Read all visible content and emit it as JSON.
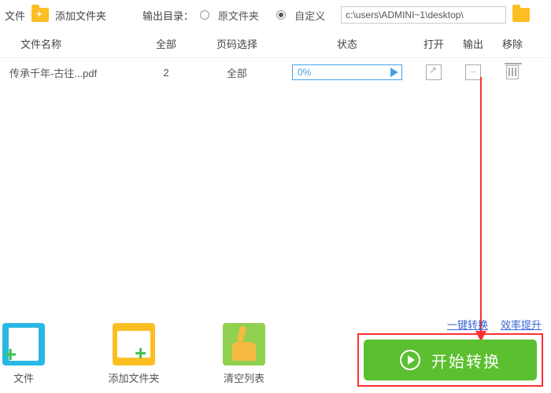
{
  "top": {
    "file_label": "文件",
    "add_folder_label": "添加文件夹",
    "output_label": "输出目录：",
    "radio_original": "原文件夹",
    "radio_custom": "自定义",
    "path": "c:\\users\\ADMINI~1\\desktop\\",
    "selected_radio": "custom"
  },
  "headers": {
    "name": "文件名称",
    "all": "全部",
    "page": "页码选择",
    "status": "状态",
    "open": "打开",
    "output": "输出",
    "remove": "移除"
  },
  "rows": [
    {
      "name": "传承千年-古往...pdf",
      "all": "2",
      "page": "全部",
      "progress": "0%"
    }
  ],
  "bottom": {
    "add_file": "文件",
    "add_folder": "添加文件夹",
    "clear": "清空列表"
  },
  "promo": {
    "link1": "一键转换",
    "link2": "效率提升"
  },
  "start_label": "开始转换"
}
